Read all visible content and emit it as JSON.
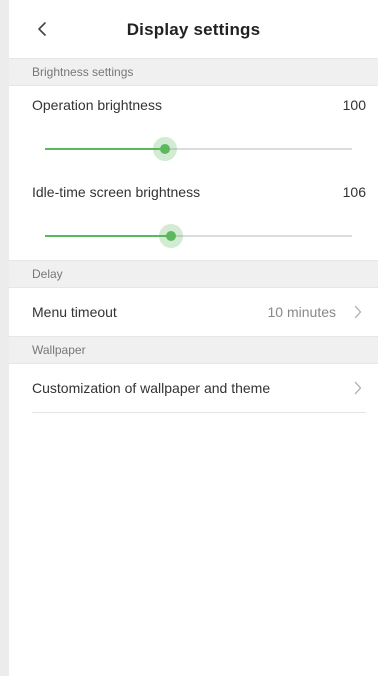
{
  "header": {
    "title": "Display settings",
    "back_icon": "chevron-left-icon"
  },
  "brightness": {
    "section_label": "Brightness settings",
    "operation": {
      "label": "Operation brightness",
      "value": "100",
      "level": 0.39
    },
    "idle": {
      "label": "Idle-time screen brightness",
      "value": "106",
      "level": 0.41
    }
  },
  "delay": {
    "section_label": "Delay",
    "menu_timeout": {
      "label": "Menu timeout",
      "value": "10 minutes",
      "icon": "chevron-right-icon"
    }
  },
  "wallpaper": {
    "section_label": "Wallpaper",
    "customization": {
      "label": "Customization of wallpaper and theme",
      "icon": "chevron-right-icon"
    }
  },
  "colors": {
    "accent": "#5cb85c",
    "section_bg": "#f0f0f0",
    "track": "#dcdcdc"
  }
}
